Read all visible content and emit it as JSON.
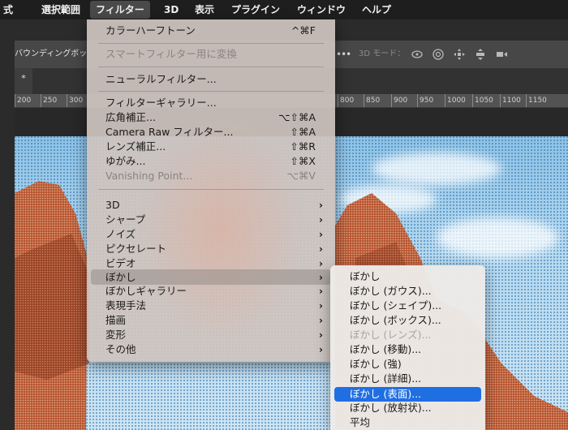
{
  "menubar": {
    "items": [
      "式",
      "選択範囲",
      "フィルター",
      "3D",
      "表示",
      "プラグイン",
      "ウィンドウ",
      "ヘルプ"
    ]
  },
  "options_bar": {
    "label": "バウンディングボッ",
    "dots": "•••",
    "mode_label": "3D モード：",
    "icons": [
      "rotate-3d-icon",
      "roll-3d-icon",
      "pan-3d-icon",
      "slide-3d-icon",
      "scale-3d-icon"
    ]
  },
  "tab": {
    "label": "*"
  },
  "ruler": {
    "left_ticks": [
      "200",
      "250",
      "300"
    ],
    "right_ticks": [
      "800",
      "850",
      "900",
      "950",
      "1000",
      "1050",
      "1100",
      "1150"
    ]
  },
  "filter_menu": {
    "items": [
      {
        "label": "カラーハーフトーン",
        "shortcut": "^⌘F",
        "enabled": true
      },
      {
        "label": "スマートフィルター用に変換",
        "enabled": false
      },
      {
        "label": "ニューラルフィルター...",
        "enabled": true
      },
      {
        "label": "フィルターギャラリー...",
        "enabled": true
      },
      {
        "label": "広角補正...",
        "shortcut": "⌥⇧⌘A",
        "enabled": true
      },
      {
        "label": "Camera Raw フィルター...",
        "shortcut": "⇧⌘A",
        "enabled": true
      },
      {
        "label": "レンズ補正...",
        "shortcut": "⇧⌘R",
        "enabled": true
      },
      {
        "label": "ゆがみ...",
        "shortcut": "⇧⌘X",
        "enabled": true
      },
      {
        "label": "Vanishing Point...",
        "shortcut": "⌥⌘V",
        "enabled": false
      },
      {
        "label": "3D",
        "submenu": true
      },
      {
        "label": "シャープ",
        "submenu": true
      },
      {
        "label": "ノイズ",
        "submenu": true
      },
      {
        "label": "ピクセレート",
        "submenu": true
      },
      {
        "label": "ビデオ",
        "submenu": true
      },
      {
        "label": "ぼかし",
        "submenu": true,
        "highlighted": true
      },
      {
        "label": "ぼかしギャラリー",
        "submenu": true
      },
      {
        "label": "表現手法",
        "submenu": true
      },
      {
        "label": "描画",
        "submenu": true
      },
      {
        "label": "変形",
        "submenu": true
      },
      {
        "label": "その他",
        "submenu": true
      }
    ],
    "arrow": "›"
  },
  "blur_submenu": {
    "items": [
      {
        "label": "ぼかし",
        "enabled": true
      },
      {
        "label": "ぼかし (ガウス)...",
        "enabled": true
      },
      {
        "label": "ぼかし (シェイプ)...",
        "enabled": true
      },
      {
        "label": "ぼかし (ボックス)...",
        "enabled": true
      },
      {
        "label": "ぼかし (レンズ)...",
        "enabled": false
      },
      {
        "label": "ぼかし (移動)...",
        "enabled": true
      },
      {
        "label": "ぼかし (強)",
        "enabled": true
      },
      {
        "label": "ぼかし (詳細)...",
        "enabled": true
      },
      {
        "label": "ぼかし (表面)...",
        "enabled": true,
        "selected": true
      },
      {
        "label": "ぼかし (放射状)...",
        "enabled": true
      },
      {
        "label": "平均",
        "enabled": true
      }
    ]
  },
  "colors": {
    "menubar_bg": "#1e1e1e",
    "selection_blue": "#1f6fe2",
    "rock": "#b5532f",
    "sky": "#a9d3ee"
  }
}
